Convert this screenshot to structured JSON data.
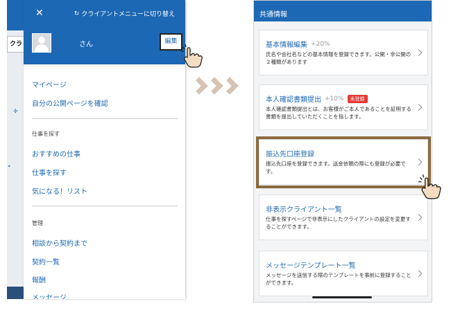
{
  "background_app": {
    "tab_label": "クラ"
  },
  "drawer": {
    "switch_label": "クライアントメニューに切り替え",
    "user_name": "さん",
    "edit_label": "編集",
    "items_top": [
      "マイページ",
      "自分の公開ページを確認"
    ],
    "section_find": "仕事を探す",
    "items_find": [
      "おすすめの仕事",
      "仕事を探す",
      "気になる！リスト"
    ],
    "section_manage": "管理",
    "items_manage": [
      "相談から契約まで",
      "契約一覧",
      "報酬",
      "メッセージ"
    ]
  },
  "right": {
    "header": "共通情報",
    "cards": [
      {
        "title": "基本情報編集",
        "pct": "+20%",
        "badge": "",
        "desc": "氏名や会社名などの基本情報を登録できます。公開・非公開の２種類があります"
      },
      {
        "title": "本人確認書類提出",
        "pct": "+10%",
        "badge": "未登録",
        "desc": "本人確認書類提出とは、お客様がご本人であることを証明する書類を提出していただくことを指します。"
      },
      {
        "title": "振込先口座登録",
        "pct": "",
        "badge": "",
        "desc": "振込先口座を登録できます。送金依頼の際にも登録が必要です。"
      },
      {
        "title": "非表示クライアント一覧",
        "pct": "",
        "badge": "",
        "desc": "仕事を探すページで非表示にしたクライアントの設定を変更することができます。"
      },
      {
        "title": "メッセージテンプレート一覧",
        "pct": "",
        "badge": "",
        "desc": "メッセージを送信する際のテンプレートを事前に登録することができます。"
      }
    ]
  },
  "colors": {
    "primary": "#1d68b4",
    "highlight": "#8b6a3e",
    "badge": "#e53935",
    "arrow": "#d7c3b3"
  }
}
